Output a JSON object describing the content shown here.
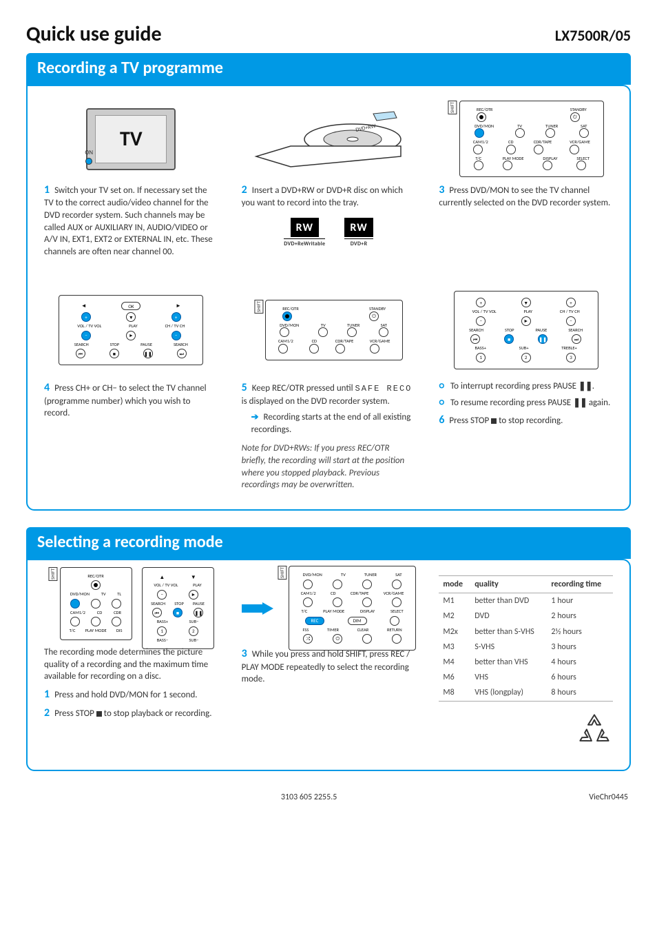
{
  "header": {
    "title": "Quick use guide",
    "model": "LX7500R/05"
  },
  "section1": {
    "title": "Recording a TV programme",
    "tv_label": "TV",
    "tv_on": "ON",
    "step1_num": "1",
    "step1": "Switch your TV set on. If necessary set the TV to the correct audio/video channel for the DVD recorder system. Such channels may be called AUX or AUXILIARY IN, AUDIO/VIDEO or A/V IN, EXT1, EXT2 or EXTERNAL IN, etc. These channels are often near channel 00.",
    "step2_num": "2",
    "step2": "Insert a DVD+RW or DVD+R disc on which you want to record into the tray.",
    "rw1_top": "RW",
    "rw1_sub": "DVD+ReWritable",
    "rw2_top": "RW",
    "rw2_sub": "DVD+R",
    "step3_num": "3",
    "step3": "Press DVD/MON to see the TV channel currently selected on the DVD recorder system.",
    "step4_num": "4",
    "step4": "Press CH+ or CH− to select the TV channel (programme number) which you wish to record.",
    "step5_num": "5",
    "step5a": "Keep REC/OTR pressed until ",
    "step5_code": "SAFE RECO",
    "step5b": " is displayed on the DVD recorder system.",
    "step5_arrow": "Recording starts at the end of all existing recordings.",
    "step5_note": "Note for DVD+RWs: If you press REC/OTR briefly, the recording will start at the position where you stopped playback. Previous recordings may be overwritten.",
    "tip1": "To interrupt recording press PAUSE ",
    "tip1b": ".",
    "tip2": "To resume recording press PAUSE ",
    "tip2b": " again.",
    "step6_num": "6",
    "step6a": "Press STOP ",
    "step6b": " to stop recording.",
    "panel_labels": {
      "rec": "REC/OTR",
      "standby": "STANDBY",
      "dvdmon": "DVD/MON",
      "tv": "TV",
      "tuner": "TUNER",
      "sat": "SAT",
      "cam": "CAM1/2",
      "cd": "CD",
      "cdr": "CDR/TAPE",
      "vcr": "VCR/GAME",
      "tc": "T/C",
      "playmode": "PLAY MODE",
      "display": "DISPLAY",
      "select": "SELECT",
      "shift": "SHIFT"
    },
    "remote_labels": {
      "ok": "OK",
      "voltv": "VOL / TV VOL",
      "play": "PLAY",
      "chtv": "CH / TV CH",
      "search": "SEARCH",
      "stop": "STOP",
      "pause": "PAUSE",
      "bassp": "BASS+",
      "subp": "SUB+",
      "treblep": "TREBLE+",
      "n1": "1",
      "n2": "2",
      "n3": "3"
    }
  },
  "section2": {
    "title": "Selecting a recording mode",
    "intro": "The recording mode determines the picture quality of a recording and the maximum time available for recording on a disc.",
    "step1_num": "1",
    "step1": "Press and hold DVD/MON for 1 second.",
    "step2_num": "2",
    "step2a": "Press STOP ",
    "step2b": " to stop playback or recording.",
    "step3_num": "3",
    "step3": "While you press and hold SHIFT, press REC / PLAY MODE repeatedly to select the recording mode.",
    "panel2": {
      "fss": "FSS",
      "timer": "TIMER",
      "clear": "CLEAR",
      "return": "RETURN",
      "rec": "REC",
      "dim": "DIM"
    },
    "table": {
      "h_mode": "mode",
      "h_quality": "quality",
      "h_time": "recording time",
      "rows": [
        {
          "mode": "M1",
          "quality": "better than DVD",
          "time": "1 hour"
        },
        {
          "mode": "M2",
          "quality": "DVD",
          "time": "2 hours"
        },
        {
          "mode": "M2x",
          "quality": "better than S-VHS",
          "time": "2½ hours"
        },
        {
          "mode": "M3",
          "quality": "S-VHS",
          "time": "3 hours"
        },
        {
          "mode": "M4",
          "quality": "better than VHS",
          "time": "4 hours"
        },
        {
          "mode": "M6",
          "quality": "VHS",
          "time": "6 hours"
        },
        {
          "mode": "M8",
          "quality": "VHS (longplay)",
          "time": "8 hours"
        }
      ]
    }
  },
  "footer": {
    "center": "3103 605 2255.5",
    "right": "VieChr0445"
  }
}
